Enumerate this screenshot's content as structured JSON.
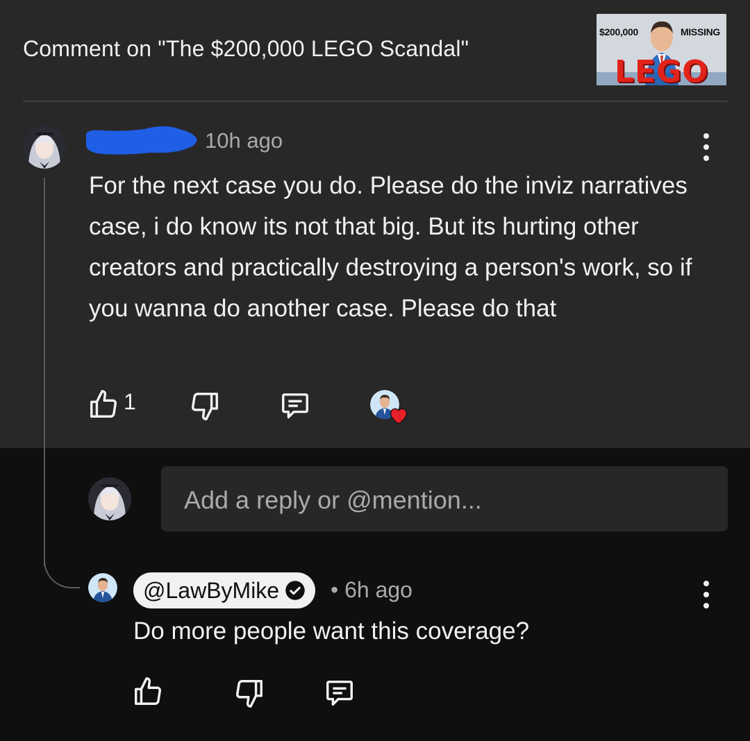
{
  "header": {
    "title": "Comment on \"The $200,000 LEGO Scandal\"",
    "thumbnail": {
      "left_text": "$200,000",
      "right_text": "MISSING",
      "big_text": "LEGO"
    }
  },
  "comment": {
    "timestamp": "10h ago",
    "text": "For the next case you do. Please do the inviz narratives case, i do know its not that big. But its hurting other creators and practically destroying a person's work, so if you wanna do another case. Please do that",
    "like_count": "1",
    "hearted": true
  },
  "reply_input": {
    "placeholder": "Add a reply or @mention..."
  },
  "reply": {
    "handle": "@LawByMike",
    "verified": true,
    "meta": "• 6h ago",
    "text": "Do more people want this coverage?"
  },
  "colors": {
    "panel": "#282828",
    "background": "#0f0f0f",
    "text": "#f1f1f1",
    "muted": "#aaaaaa",
    "redaction": "#1f5fe6",
    "heart": "#e8202a"
  },
  "icons": [
    "like-icon",
    "dislike-icon",
    "reply-icon",
    "more-vert-icon",
    "verified-check-icon",
    "heart-icon"
  ]
}
